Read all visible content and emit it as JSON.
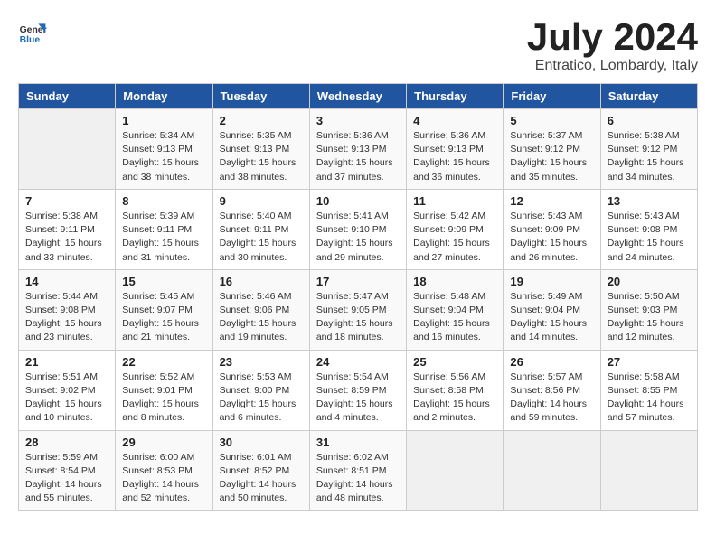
{
  "header": {
    "logo_line1": "General",
    "logo_line2": "Blue",
    "title": "July 2024",
    "subtitle": "Entratico, Lombardy, Italy"
  },
  "calendar": {
    "days_of_week": [
      "Sunday",
      "Monday",
      "Tuesday",
      "Wednesday",
      "Thursday",
      "Friday",
      "Saturday"
    ],
    "weeks": [
      [
        {
          "day": "",
          "info": ""
        },
        {
          "day": "1",
          "info": "Sunrise: 5:34 AM\nSunset: 9:13 PM\nDaylight: 15 hours\nand 38 minutes."
        },
        {
          "day": "2",
          "info": "Sunrise: 5:35 AM\nSunset: 9:13 PM\nDaylight: 15 hours\nand 38 minutes."
        },
        {
          "day": "3",
          "info": "Sunrise: 5:36 AM\nSunset: 9:13 PM\nDaylight: 15 hours\nand 37 minutes."
        },
        {
          "day": "4",
          "info": "Sunrise: 5:36 AM\nSunset: 9:13 PM\nDaylight: 15 hours\nand 36 minutes."
        },
        {
          "day": "5",
          "info": "Sunrise: 5:37 AM\nSunset: 9:12 PM\nDaylight: 15 hours\nand 35 minutes."
        },
        {
          "day": "6",
          "info": "Sunrise: 5:38 AM\nSunset: 9:12 PM\nDaylight: 15 hours\nand 34 minutes."
        }
      ],
      [
        {
          "day": "7",
          "info": "Sunrise: 5:38 AM\nSunset: 9:11 PM\nDaylight: 15 hours\nand 33 minutes."
        },
        {
          "day": "8",
          "info": "Sunrise: 5:39 AM\nSunset: 9:11 PM\nDaylight: 15 hours\nand 31 minutes."
        },
        {
          "day": "9",
          "info": "Sunrise: 5:40 AM\nSunset: 9:11 PM\nDaylight: 15 hours\nand 30 minutes."
        },
        {
          "day": "10",
          "info": "Sunrise: 5:41 AM\nSunset: 9:10 PM\nDaylight: 15 hours\nand 29 minutes."
        },
        {
          "day": "11",
          "info": "Sunrise: 5:42 AM\nSunset: 9:09 PM\nDaylight: 15 hours\nand 27 minutes."
        },
        {
          "day": "12",
          "info": "Sunrise: 5:43 AM\nSunset: 9:09 PM\nDaylight: 15 hours\nand 26 minutes."
        },
        {
          "day": "13",
          "info": "Sunrise: 5:43 AM\nSunset: 9:08 PM\nDaylight: 15 hours\nand 24 minutes."
        }
      ],
      [
        {
          "day": "14",
          "info": "Sunrise: 5:44 AM\nSunset: 9:08 PM\nDaylight: 15 hours\nand 23 minutes."
        },
        {
          "day": "15",
          "info": "Sunrise: 5:45 AM\nSunset: 9:07 PM\nDaylight: 15 hours\nand 21 minutes."
        },
        {
          "day": "16",
          "info": "Sunrise: 5:46 AM\nSunset: 9:06 PM\nDaylight: 15 hours\nand 19 minutes."
        },
        {
          "day": "17",
          "info": "Sunrise: 5:47 AM\nSunset: 9:05 PM\nDaylight: 15 hours\nand 18 minutes."
        },
        {
          "day": "18",
          "info": "Sunrise: 5:48 AM\nSunset: 9:04 PM\nDaylight: 15 hours\nand 16 minutes."
        },
        {
          "day": "19",
          "info": "Sunrise: 5:49 AM\nSunset: 9:04 PM\nDaylight: 15 hours\nand 14 minutes."
        },
        {
          "day": "20",
          "info": "Sunrise: 5:50 AM\nSunset: 9:03 PM\nDaylight: 15 hours\nand 12 minutes."
        }
      ],
      [
        {
          "day": "21",
          "info": "Sunrise: 5:51 AM\nSunset: 9:02 PM\nDaylight: 15 hours\nand 10 minutes."
        },
        {
          "day": "22",
          "info": "Sunrise: 5:52 AM\nSunset: 9:01 PM\nDaylight: 15 hours\nand 8 minutes."
        },
        {
          "day": "23",
          "info": "Sunrise: 5:53 AM\nSunset: 9:00 PM\nDaylight: 15 hours\nand 6 minutes."
        },
        {
          "day": "24",
          "info": "Sunrise: 5:54 AM\nSunset: 8:59 PM\nDaylight: 15 hours\nand 4 minutes."
        },
        {
          "day": "25",
          "info": "Sunrise: 5:56 AM\nSunset: 8:58 PM\nDaylight: 15 hours\nand 2 minutes."
        },
        {
          "day": "26",
          "info": "Sunrise: 5:57 AM\nSunset: 8:56 PM\nDaylight: 14 hours\nand 59 minutes."
        },
        {
          "day": "27",
          "info": "Sunrise: 5:58 AM\nSunset: 8:55 PM\nDaylight: 14 hours\nand 57 minutes."
        }
      ],
      [
        {
          "day": "28",
          "info": "Sunrise: 5:59 AM\nSunset: 8:54 PM\nDaylight: 14 hours\nand 55 minutes."
        },
        {
          "day": "29",
          "info": "Sunrise: 6:00 AM\nSunset: 8:53 PM\nDaylight: 14 hours\nand 52 minutes."
        },
        {
          "day": "30",
          "info": "Sunrise: 6:01 AM\nSunset: 8:52 PM\nDaylight: 14 hours\nand 50 minutes."
        },
        {
          "day": "31",
          "info": "Sunrise: 6:02 AM\nSunset: 8:51 PM\nDaylight: 14 hours\nand 48 minutes."
        },
        {
          "day": "",
          "info": ""
        },
        {
          "day": "",
          "info": ""
        },
        {
          "day": "",
          "info": ""
        }
      ]
    ]
  }
}
